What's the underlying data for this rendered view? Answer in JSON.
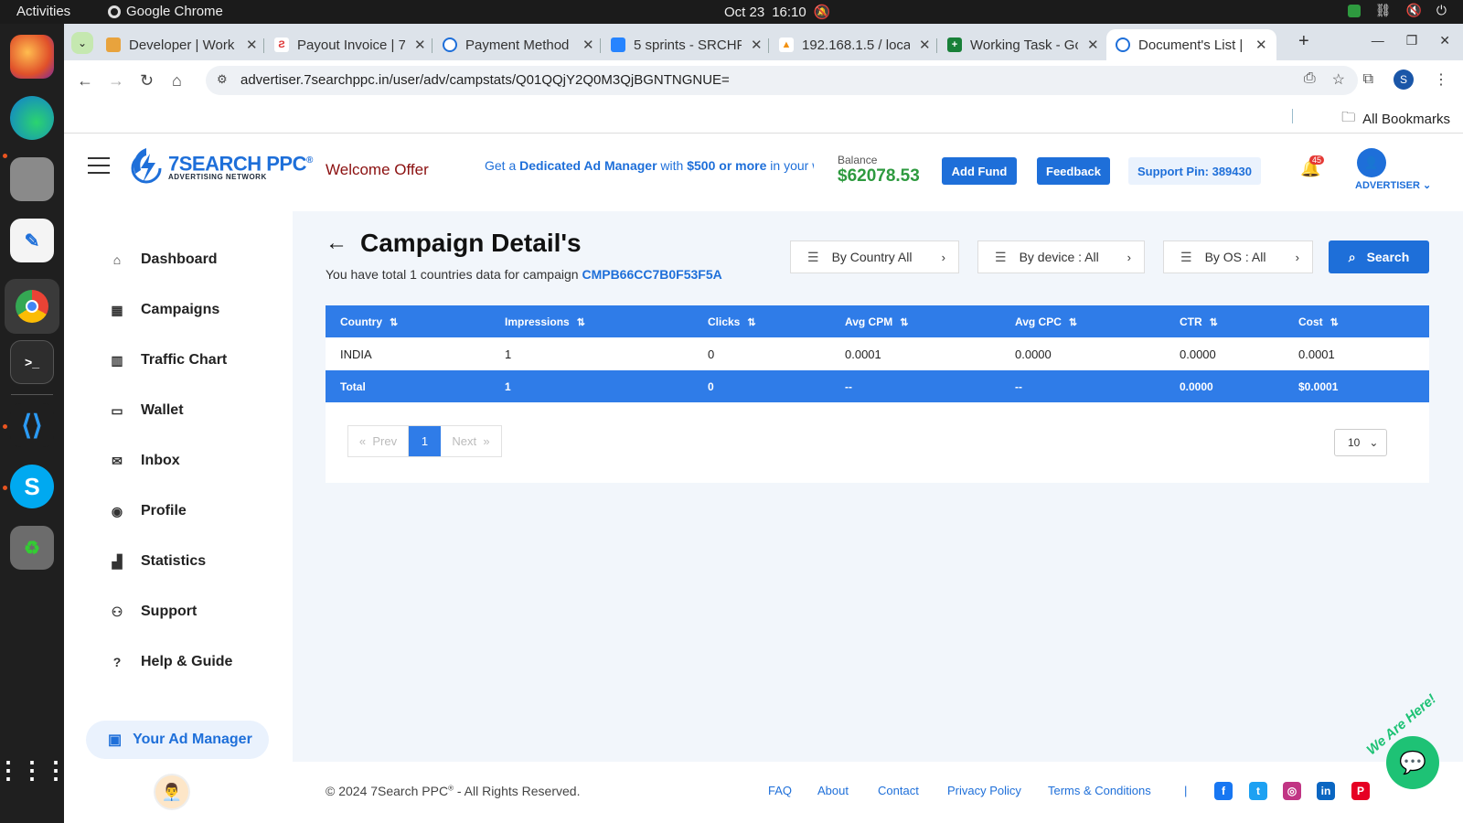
{
  "os": {
    "activities": "Activities",
    "app_name": "Google Chrome",
    "date": "Oct 23",
    "time": "16:10"
  },
  "browser": {
    "tabs": [
      {
        "title": "Developer | Work",
        "favicon_color": "#e8a33d"
      },
      {
        "title": "Payout Invoice | 7",
        "favicon_color": "#d33"
      },
      {
        "title": "Payment Method",
        "favicon_color": "#1e6fd9"
      },
      {
        "title": "5 sprints - SRCHP",
        "favicon_color": "#2684ff"
      },
      {
        "title": "192.168.1.5 / loca",
        "favicon_color": "#f29111"
      },
      {
        "title": "Working Task - Go",
        "favicon_color": "#188038"
      },
      {
        "title": "Document's List |",
        "favicon_color": "#1e6fd9"
      }
    ],
    "url": "advertiser.7searchppc.in/user/adv/campstats/Q01QQjY2Q0M3QjBGNTNGNUE=",
    "profile_initial": "S",
    "all_bookmarks": "All Bookmarks"
  },
  "header": {
    "brand": "7SEARCH PPC",
    "brand_reg": "®",
    "tagline": "ADVERTISING NETWORK",
    "welcome": "Welcome Offer",
    "ticker_parts": [
      "Get a ",
      "Dedicated Ad Manager",
      " with ",
      "$500 or more",
      " in your wa"
    ],
    "balance_label": "Balance",
    "balance_value": "$62078.53",
    "add_fund": "Add Fund",
    "feedback": "Feedback",
    "support_pin": "Support Pin: 389430",
    "notification_count": "45",
    "user_role": "ADVERTISER"
  },
  "sidebar": {
    "items": [
      {
        "label": "Dashboard",
        "icon": "home-icon"
      },
      {
        "label": "Campaigns",
        "icon": "campaigns-icon"
      },
      {
        "label": "Traffic Chart",
        "icon": "bar-chart-icon"
      },
      {
        "label": "Wallet",
        "icon": "wallet-icon"
      },
      {
        "label": "Inbox",
        "icon": "inbox-icon"
      },
      {
        "label": "Profile",
        "icon": "profile-icon"
      },
      {
        "label": "Statistics",
        "icon": "statistics-icon"
      },
      {
        "label": "Support",
        "icon": "support-icon"
      },
      {
        "label": "Help & Guide",
        "icon": "help-icon"
      }
    ],
    "ad_manager": "Your Ad Manager"
  },
  "main": {
    "title": "Campaign Detail's",
    "subtitle_prefix": "You have total 1 countries data for campaign ",
    "campaign_id": "CMPB66CC7B0F53F5A",
    "filters": {
      "country": "By Country All",
      "device": "By device : All",
      "os": "By OS : All"
    },
    "search": "Search",
    "table": {
      "columns": [
        "Country",
        "Impressions",
        "Clicks",
        "Avg CPM",
        "Avg CPC",
        "CTR",
        "Cost"
      ],
      "rows": [
        [
          "INDIA",
          "1",
          "0",
          "0.0001",
          "0.0000",
          "0.0000",
          "0.0001"
        ]
      ],
      "total": [
        "Total",
        "1",
        "0",
        "--",
        "--",
        "0.0000",
        "$0.0001"
      ]
    },
    "pagination": {
      "prev": "Prev",
      "current": "1",
      "next": "Next",
      "page_size": "10"
    }
  },
  "footer": {
    "copyright_prefix": "© 2024 7Search PPC",
    "copyright_reg": "®",
    "copyright_suffix": " - All Rights Reserved.",
    "links": [
      "FAQ",
      "About",
      "Contact",
      "Privacy Policy",
      "Terms & Conditions"
    ],
    "separator": "|",
    "chat_label": "We Are Here!"
  }
}
